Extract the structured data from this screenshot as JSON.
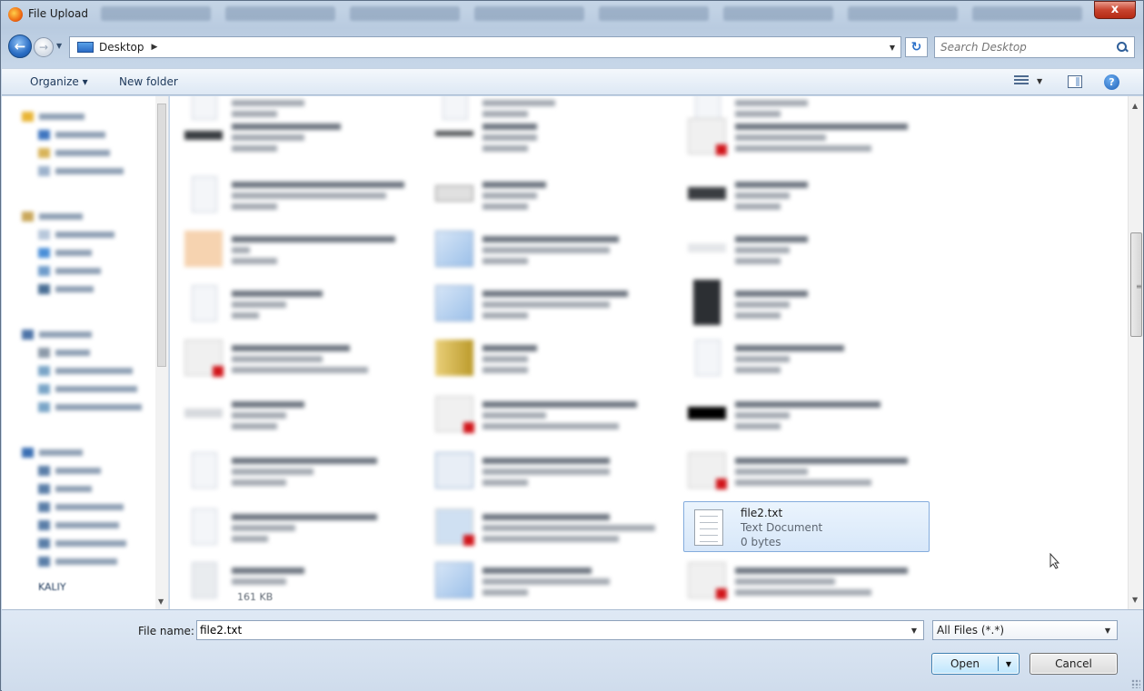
{
  "window": {
    "title": "File Upload",
    "close_label": "x"
  },
  "address_bar": {
    "crumbs": [
      "Desktop"
    ],
    "search_placeholder": "Search Desktop"
  },
  "toolbar": {
    "organize_label": "Organize ▾",
    "new_folder_label": "New folder"
  },
  "nav_pane": {
    "visible_item": "KALIY"
  },
  "file_list": {
    "selected": {
      "name": "file2.txt",
      "type": "Text Document",
      "size": "0 bytes"
    },
    "visible_size_text": "161 KB"
  },
  "footer": {
    "file_name_label": "File name:",
    "file_name_value": "file2.txt",
    "filter_value": "All Files (*.*)",
    "open_label": "Open",
    "cancel_label": "Cancel"
  },
  "colors": {
    "selection_fill": "#d7e7f9",
    "selection_border": "#84acdd",
    "close_button": "#c8432e"
  },
  "icons": [
    "firefox-icon",
    "back-icon",
    "forward-icon",
    "folder-icon",
    "refresh-icon",
    "search-icon",
    "view-icon",
    "preview-pane-icon",
    "help-icon",
    "text-file-icon",
    "cursor-icon"
  ]
}
